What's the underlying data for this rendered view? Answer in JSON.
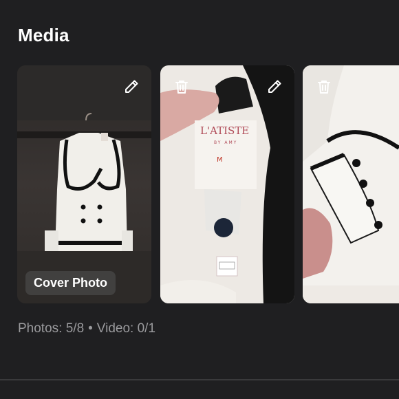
{
  "section": {
    "title": "Media"
  },
  "media": {
    "cover_label": "Cover Photo",
    "items": [
      {
        "kind": "photo",
        "description_icon": "edit-icon"
      },
      {
        "kind": "photo",
        "tag_text": "L'ATISTE",
        "tag_sub": "BY AMY",
        "tag_size": "M"
      },
      {
        "kind": "photo"
      }
    ]
  },
  "counts": {
    "photos_label": "Photos:",
    "photos_value": "5/8",
    "separator": "•",
    "video_label": "Video:",
    "video_value": "0/1"
  },
  "colors": {
    "background": "#1f1f21",
    "muted_text": "#9a9a9d",
    "divider": "#3a3a3c"
  }
}
